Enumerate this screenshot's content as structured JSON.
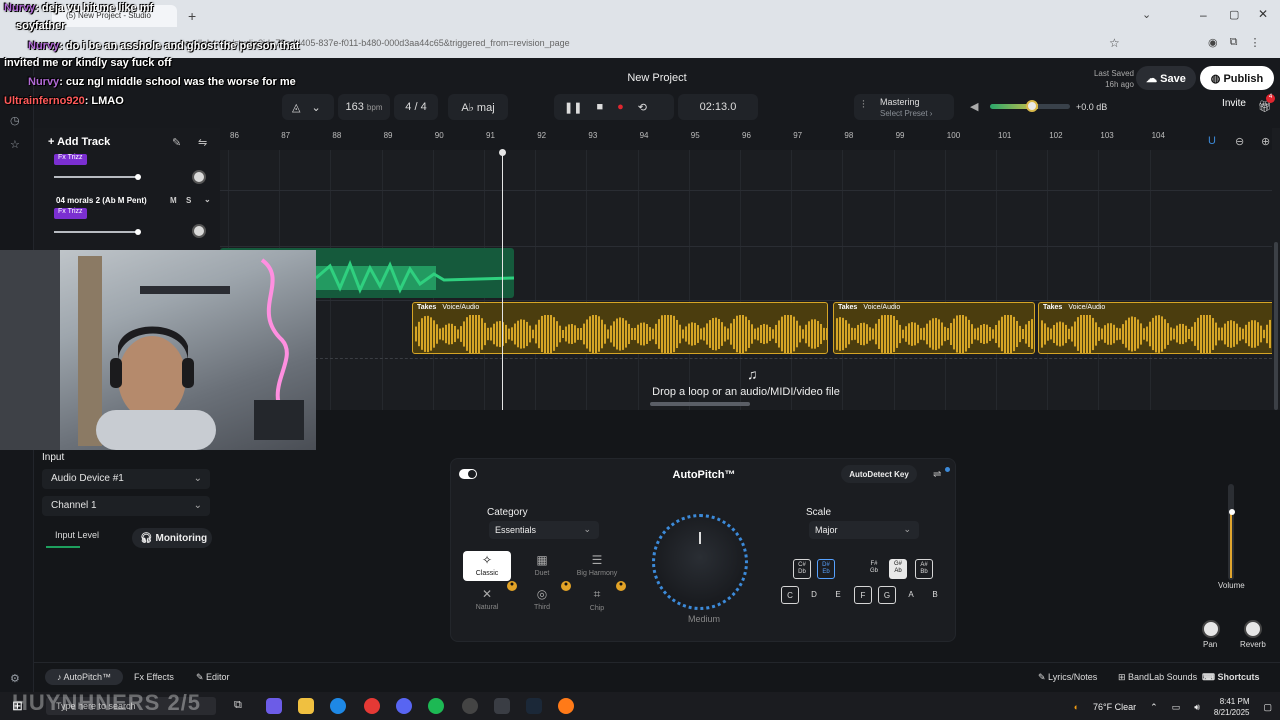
{
  "browser": {
    "tab_title": "(5) New Project - Studio",
    "address": "bandlab.com/studio?id=78add405-837e-f011-b480-000d3aa44c65&triggered_from=revision_page"
  },
  "chat": [
    {
      "user": "Nurvy",
      "text": ": deja vu hit me like mf"
    },
    {
      "user": "",
      "text": "soyfather"
    },
    {
      "user": "Nurvy",
      "text": ": do i be an asshole and ghost the person that"
    },
    {
      "user": "",
      "text": "invited me or kindly say fuck off"
    },
    {
      "user": "Nurvy",
      "text": ": cuz ngl middle school was the worse for me"
    },
    {
      "user": "Ultrainferno920",
      "text": ": LMAO"
    }
  ],
  "header": {
    "brand": "BandLab",
    "project_title": "New Project",
    "last_saved_label": "Last Saved",
    "last_saved_value": "16h ago",
    "save_label": "Save",
    "publish_label": "Publish",
    "invite_label": "Invite",
    "notif_count": "4"
  },
  "transport": {
    "bpm": "163",
    "bpm_unit": "bpm",
    "time_signature": "4 / 4",
    "key": "A♭ maj",
    "position": "02:13.0",
    "mastering_label": "Mastering",
    "mastering_preset": "Select Preset ›",
    "master_db": "+0.0 dB",
    "master_volume_pct": 60
  },
  "tracks": {
    "add_track_label": "Add Track",
    "items": [
      {
        "name": "",
        "fx": "Fx Trizz"
      },
      {
        "name": "04  morals 2 (Ab M Pent)",
        "fx": "Fx Trizz",
        "mute": "M",
        "solo": "S"
      }
    ]
  },
  "timeline": {
    "ruler": [
      "86",
      "87",
      "88",
      "89",
      "90",
      "91",
      "92",
      "93",
      "94",
      "95",
      "96",
      "97",
      "98",
      "99",
      "100",
      "101",
      "102",
      "103",
      "104"
    ],
    "clips": [
      {
        "label": "Takes",
        "type": "Voice/Audio"
      },
      {
        "label": "Takes",
        "type": "Voice/Audio"
      },
      {
        "label": "Takes",
        "type": "Voice/Audio"
      }
    ],
    "drop_text": "Drop a loop or an audio/MIDI/video file"
  },
  "input": {
    "heading": "Input",
    "device": "Audio Device #1",
    "channel": "Channel 1",
    "level_label": "Input Level",
    "monitoring_label": "Monitoring"
  },
  "autopitch": {
    "title": "AutoPitch™",
    "autodetect_label": "AutoDetect Key",
    "category_label": "Category",
    "category_value": "Essentials",
    "scale_label": "Scale",
    "scale_value": "Major",
    "amount_label": "Medium",
    "effects": [
      "Classic",
      "Duet",
      "Big Harmony",
      "Natural",
      "Third",
      "Chip"
    ],
    "sharp_keys": [
      "C#\nDb",
      "D#\nEb",
      "F#\nGb",
      "G#\nAb",
      "A#\nBb"
    ],
    "natural_keys": [
      "C",
      "D",
      "E",
      "F",
      "G",
      "A",
      "B"
    ]
  },
  "mixer": {
    "volume_label": "Volume",
    "pan_label": "Pan",
    "reverb_label": "Reverb"
  },
  "bottom_tabs": {
    "autopitch": "AutoPitch™",
    "effects": "Effects",
    "editor": "Editor",
    "lyrics": "Lyrics/Notes",
    "sounds": "BandLab Sounds",
    "shortcuts": "Shortcuts"
  },
  "taskbar": {
    "search_placeholder": "Type here to search",
    "weather": "76°F  Clear",
    "time": "8:41 PM",
    "date": "8/21/2025",
    "watermark": "HUYNHNERS 2/5"
  },
  "colors": {
    "accent": "#e3a326",
    "clip_audio": "#d6a526",
    "clip_green": "#1ea05e",
    "record": "#e0262f"
  }
}
